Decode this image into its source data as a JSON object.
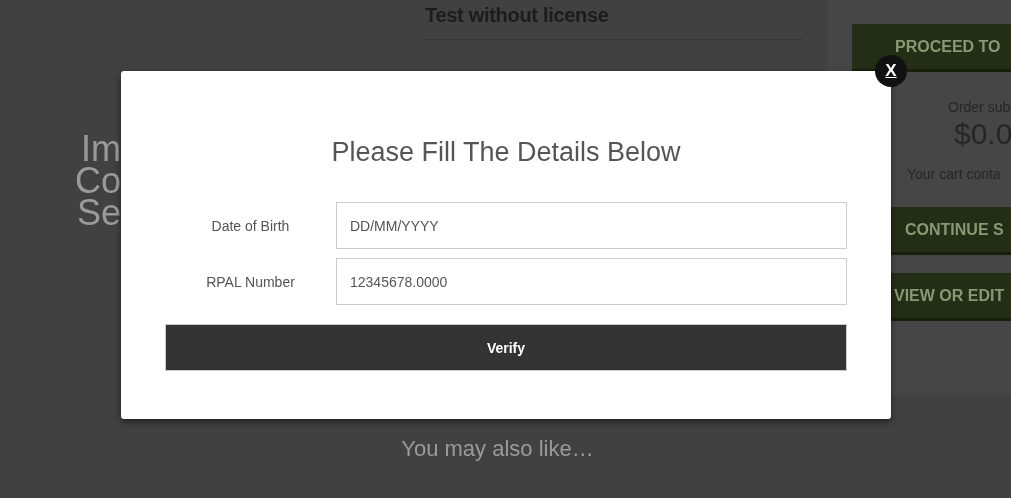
{
  "background": {
    "image_text": [
      "Im",
      "Co",
      "Se"
    ],
    "product": {
      "title": "Test without license"
    },
    "cart": {
      "proceed_button": "PROCEED TO",
      "subtotal_label": "Order sub",
      "subtotal": "$0.0",
      "cart_note": "Your cart conta",
      "continue_button": "CONTINUE S",
      "view_button": "VIEW OR EDIT"
    },
    "related_heading": "You may also like…"
  },
  "modal": {
    "title": "Please Fill The Details Below",
    "fields": [
      {
        "label": "Date of Birth",
        "placeholder": "DD/MM/YYYY"
      },
      {
        "label": "RPAL Number",
        "value": "12345678.0000"
      }
    ],
    "submit": "Verify",
    "close": "X"
  }
}
